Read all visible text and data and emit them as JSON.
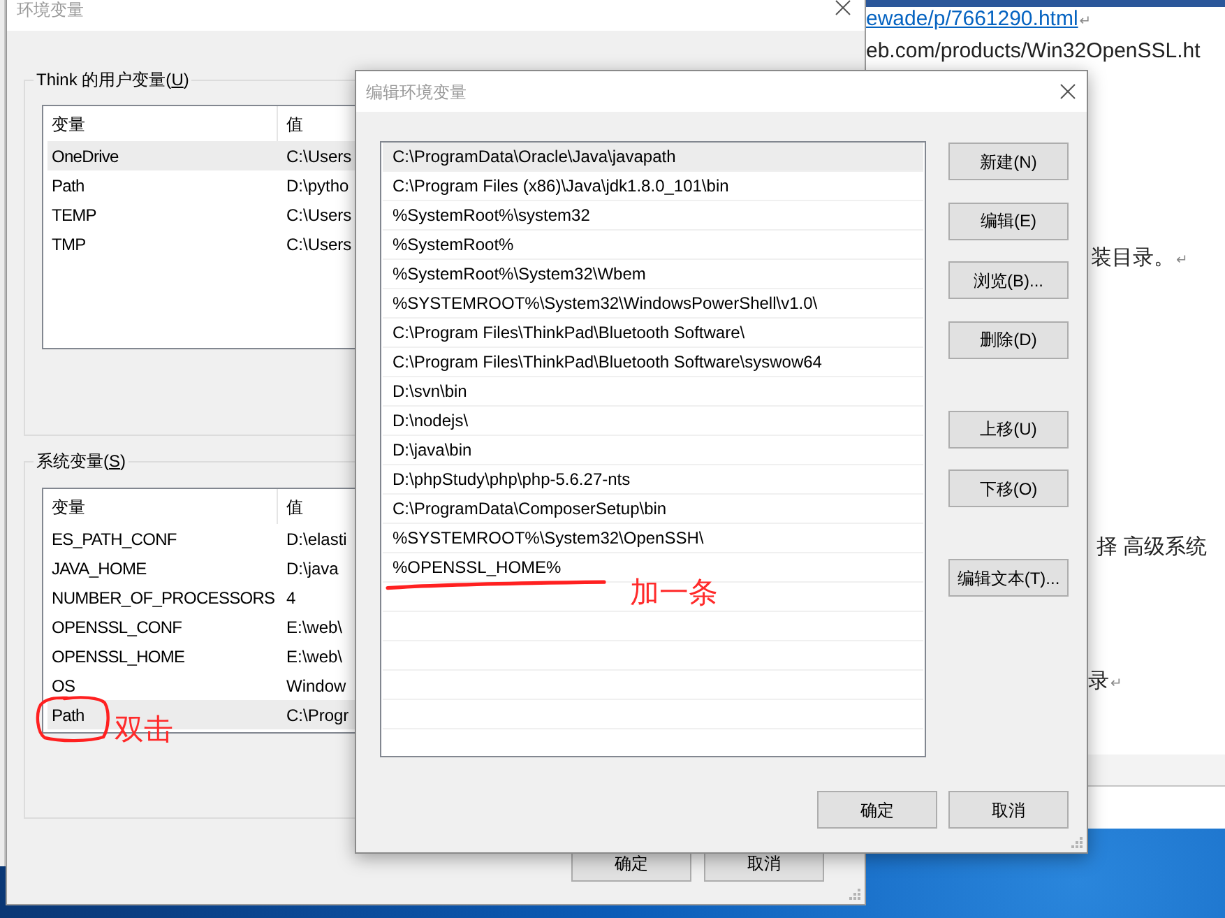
{
  "document": {
    "top_lines": [
      {
        "kind": "link",
        "text": "ewade/p/7661290.html",
        "mark": "↵"
      },
      {
        "kind": "text",
        "text": "eb.com/products/Win32OpenSSL.ht"
      }
    ],
    "side_lines": [
      {
        "text": "装目录。",
        "mark": "↵"
      },
      {
        "text": "择 高级系统"
      },
      {
        "text": "录",
        "mark": "↵"
      }
    ]
  },
  "env_window": {
    "title": "环境变量",
    "user_group": {
      "label": {
        "before": "Think 的用户变量(",
        "key": "U",
        "after": ")"
      },
      "columns": [
        "变量",
        "值"
      ],
      "rows": [
        {
          "name": "OneDrive",
          "value": "C:\\Users",
          "selected": true
        },
        {
          "name": "Path",
          "value": "D:\\pytho",
          "selected": false
        },
        {
          "name": "TEMP",
          "value": "C:\\Users",
          "selected": false
        },
        {
          "name": "TMP",
          "value": "C:\\Users",
          "selected": false
        }
      ]
    },
    "system_group": {
      "label": {
        "before": "系统变量(",
        "key": "S",
        "after": ")"
      },
      "columns": [
        "变量",
        "值"
      ],
      "rows": [
        {
          "name": "ES_PATH_CONF",
          "value": "D:\\elasti",
          "selected": false
        },
        {
          "name": "JAVA_HOME",
          "value": "D:\\java",
          "selected": false
        },
        {
          "name": "NUMBER_OF_PROCESSORS",
          "value": "4",
          "selected": false
        },
        {
          "name": "OPENSSL_CONF",
          "value": "E:\\web\\",
          "selected": false
        },
        {
          "name": "OPENSSL_HOME",
          "value": "E:\\web\\",
          "selected": false
        },
        {
          "name": "OS",
          "value": "Window",
          "selected": false
        },
        {
          "name": "Path",
          "value": "C:\\Progr",
          "selected": true
        }
      ]
    },
    "buttons": [
      "确定",
      "取消"
    ]
  },
  "edit_dialog": {
    "title": "编辑环境变量",
    "entries": [
      {
        "text": "C:\\ProgramData\\Oracle\\Java\\javapath",
        "selected": true
      },
      {
        "text": "C:\\Program Files (x86)\\Java\\jdk1.8.0_101\\bin",
        "selected": false
      },
      {
        "text": "%SystemRoot%\\system32",
        "selected": false
      },
      {
        "text": "%SystemRoot%",
        "selected": false
      },
      {
        "text": "%SystemRoot%\\System32\\Wbem",
        "selected": false
      },
      {
        "text": "%SYSTEMROOT%\\System32\\WindowsPowerShell\\v1.0\\",
        "selected": false
      },
      {
        "text": "C:\\Program Files\\ThinkPad\\Bluetooth Software\\",
        "selected": false
      },
      {
        "text": "C:\\Program Files\\ThinkPad\\Bluetooth Software\\syswow64",
        "selected": false
      },
      {
        "text": "D:\\svn\\bin",
        "selected": false
      },
      {
        "text": "D:\\nodejs\\",
        "selected": false
      },
      {
        "text": "D:\\java\\bin",
        "selected": false
      },
      {
        "text": "D:\\phpStudy\\php\\php-5.6.27-nts",
        "selected": false
      },
      {
        "text": "C:\\ProgramData\\ComposerSetup\\bin",
        "selected": false
      },
      {
        "text": "%SYSTEMROOT%\\System32\\OpenSSH\\",
        "selected": false
      },
      {
        "text": "%OPENSSL_HOME%",
        "selected": false
      }
    ],
    "side_buttons": [
      [
        "新建(N)",
        "编辑(E)",
        "浏览(B)...",
        "删除(D)"
      ],
      [
        "上移(U)",
        "下移(O)"
      ],
      [
        "编辑文本(T)..."
      ]
    ],
    "buttons": [
      "确定",
      "取消"
    ]
  },
  "annotations": [
    {
      "kind": "underline"
    },
    {
      "kind": "label",
      "text": "加一条"
    },
    {
      "kind": "circle"
    },
    {
      "kind": "label",
      "text": "双击"
    }
  ]
}
